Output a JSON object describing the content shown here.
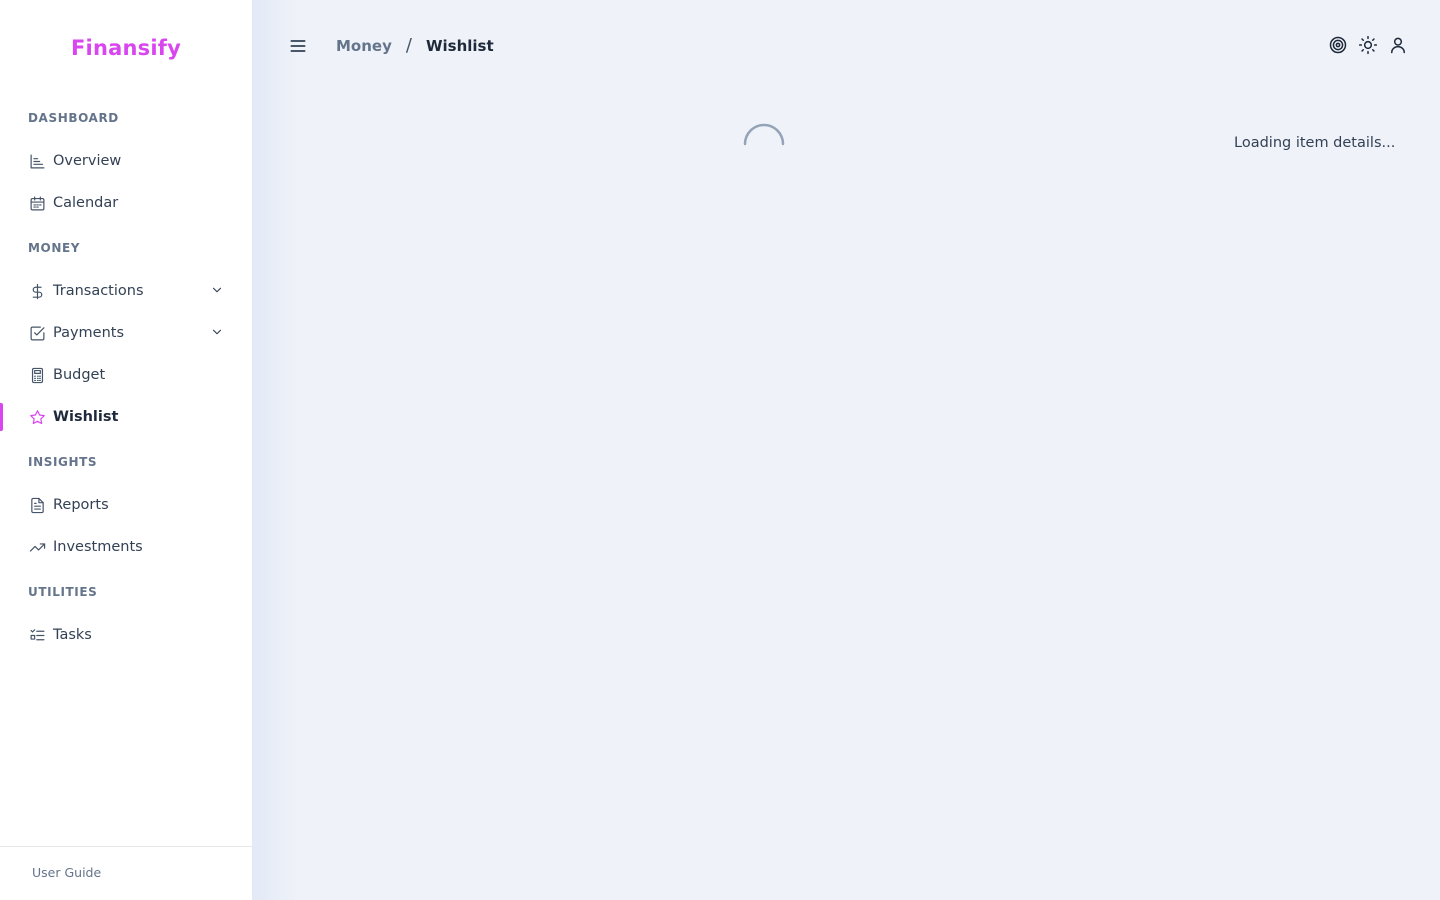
{
  "app": {
    "name": "Finansify",
    "accent_color": "#d946ef"
  },
  "sidebar": {
    "sections": [
      {
        "label": "DASHBOARD"
      },
      {
        "label": "MONEY"
      },
      {
        "label": "INSIGHTS"
      },
      {
        "label": "UTILITIES"
      }
    ],
    "items": [
      {
        "label": "Overview",
        "icon": "chart-icon"
      },
      {
        "label": "Calendar",
        "icon": "calendar-icon"
      },
      {
        "label": "Transactions",
        "icon": "dollar-icon",
        "expandable": true
      },
      {
        "label": "Payments",
        "icon": "checkbox-icon",
        "expandable": true
      },
      {
        "label": "Budget",
        "icon": "calculator-icon"
      },
      {
        "label": "Wishlist",
        "icon": "star-icon",
        "active": true
      },
      {
        "label": "Reports",
        "icon": "document-icon"
      },
      {
        "label": "Investments",
        "icon": "trend-up-icon"
      },
      {
        "label": "Tasks",
        "icon": "task-list-icon"
      }
    ],
    "footer_link": "User Guide"
  },
  "header": {
    "breadcrumb_parent": "Money",
    "breadcrumb_separator": "/",
    "breadcrumb_current": "Wishlist",
    "icons": [
      "target-icon",
      "sun-icon",
      "user-icon"
    ]
  },
  "main": {
    "loading_text": "Loading item details..."
  }
}
